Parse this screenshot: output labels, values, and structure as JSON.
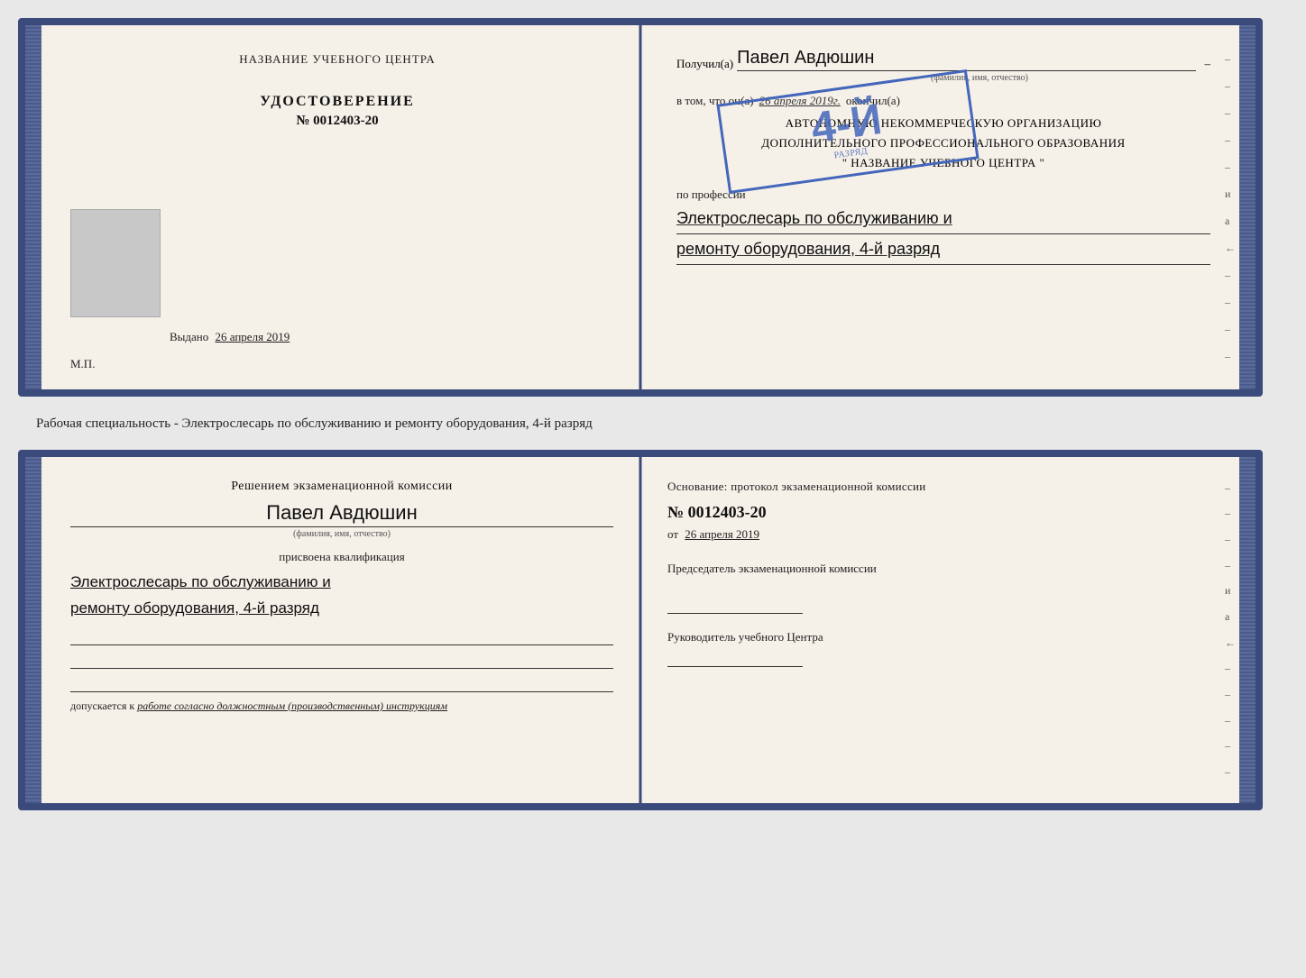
{
  "top_doc": {
    "left_page": {
      "center_title": "НАЗВАНИЕ УЧЕБНОГО ЦЕНТРА",
      "cert_label": "УДОСТОВЕРЕНИЕ",
      "cert_number": "№ 0012403-20",
      "issued_label": "Выдано",
      "issued_date": "26 апреля 2019",
      "mp_label": "М.П."
    },
    "right_page": {
      "received_label": "Получил(а)",
      "received_name": "Павел Авдюшин",
      "name_subtitle": "(фамилия, имя, отчество)",
      "vtom_label": "в том, что он(а)",
      "vtom_date": "26 апреля 2019г.",
      "finished_label": "окончил(а)",
      "org_line1": "АВТОНОМНУЮ НЕКОММЕРЧЕСКУЮ ОРГАНИЗАЦИЮ",
      "org_line2": "ДОПОЛНИТЕЛЬНОГО ПРОФЕССИОНАЛЬНОГО ОБРАЗОВАНИЯ",
      "org_line3": "\" НАЗВАНИЕ УЧЕБНОГО ЦЕНТРА \"",
      "profession_label": "по профессии",
      "profession_handwritten_1": "Электрослесарь по обслуживанию и",
      "profession_handwritten_2": "ремонту оборудования, 4-й разряд",
      "stamp_number": "4-й",
      "stamp_text": "разряд",
      "dash_chars": [
        "–",
        "–",
        "–",
        "–",
        "–",
        "и",
        "а",
        "←",
        "–",
        "–",
        "–",
        "–"
      ]
    }
  },
  "caption": "Рабочая специальность - Электрослесарь по обслуживанию и ремонту оборудования, 4-й разряд",
  "bottom_doc": {
    "left_page": {
      "commission_title": "Решением экзаменационной комиссии",
      "person_name": "Павел Авдюшин",
      "name_subtitle": "(фамилия, имя, отчество)",
      "kvalif_label": "присвоена квалификация",
      "kvalif_line1": "Электрослесарь по обслуживанию и",
      "kvalif_line2": "ремонту оборудования, 4-й разряд",
      "допуск_label": "допускается к",
      "допуск_value": "работе согласно должностным (производственным) инструкциям"
    },
    "right_page": {
      "osnov_label": "Основание: протокол экзаменационной комиссии",
      "protocol_number": "№  0012403-20",
      "date_label": "от",
      "date_value": "26 апреля 2019",
      "chairman_label": "Председатель экзаменационной комиссии",
      "director_label": "Руководитель учебного Центра",
      "dash_chars": [
        "–",
        "–",
        "–",
        "–",
        "и",
        "а",
        "←",
        "–",
        "–",
        "–",
        "–",
        "–"
      ]
    }
  }
}
